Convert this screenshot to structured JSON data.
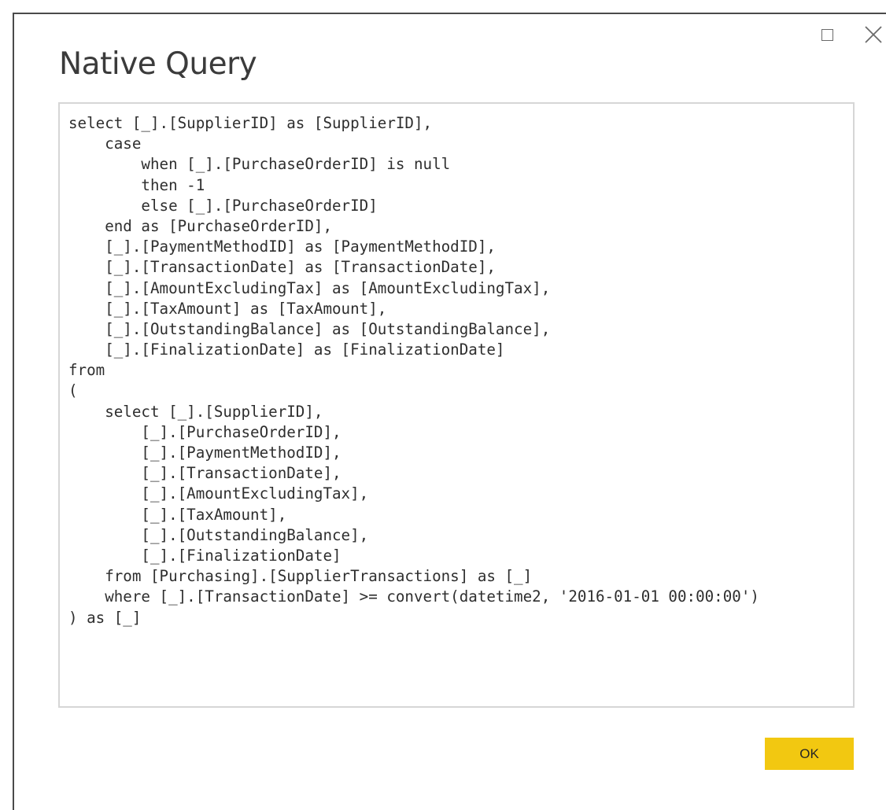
{
  "window": {
    "maximize_icon": "maximize-icon",
    "close_icon": "close-icon"
  },
  "dialog": {
    "title": "Native Query",
    "ok_label": "OK",
    "accent_color": "#f2c811"
  },
  "query": {
    "lines": [
      "select [_].[SupplierID] as [SupplierID],",
      "    case",
      "        when [_].[PurchaseOrderID] is null",
      "        then -1",
      "        else [_].[PurchaseOrderID]",
      "    end as [PurchaseOrderID],",
      "    [_].[PaymentMethodID] as [PaymentMethodID],",
      "    [_].[TransactionDate] as [TransactionDate],",
      "    [_].[AmountExcludingTax] as [AmountExcludingTax],",
      "    [_].[TaxAmount] as [TaxAmount],",
      "    [_].[OutstandingBalance] as [OutstandingBalance],",
      "    [_].[FinalizationDate] as [FinalizationDate]",
      "from",
      "(",
      "    select [_].[SupplierID],",
      "        [_].[PurchaseOrderID],",
      "        [_].[PaymentMethodID],",
      "        [_].[TransactionDate],",
      "        [_].[AmountExcludingTax],",
      "        [_].[TaxAmount],",
      "        [_].[OutstandingBalance],",
      "        [_].[FinalizationDate]",
      "    from [Purchasing].[SupplierTransactions] as [_]",
      "    where [_].[TransactionDate] >= convert(datetime2, '2016-01-01 00:00:00')",
      ") as [_]"
    ]
  }
}
